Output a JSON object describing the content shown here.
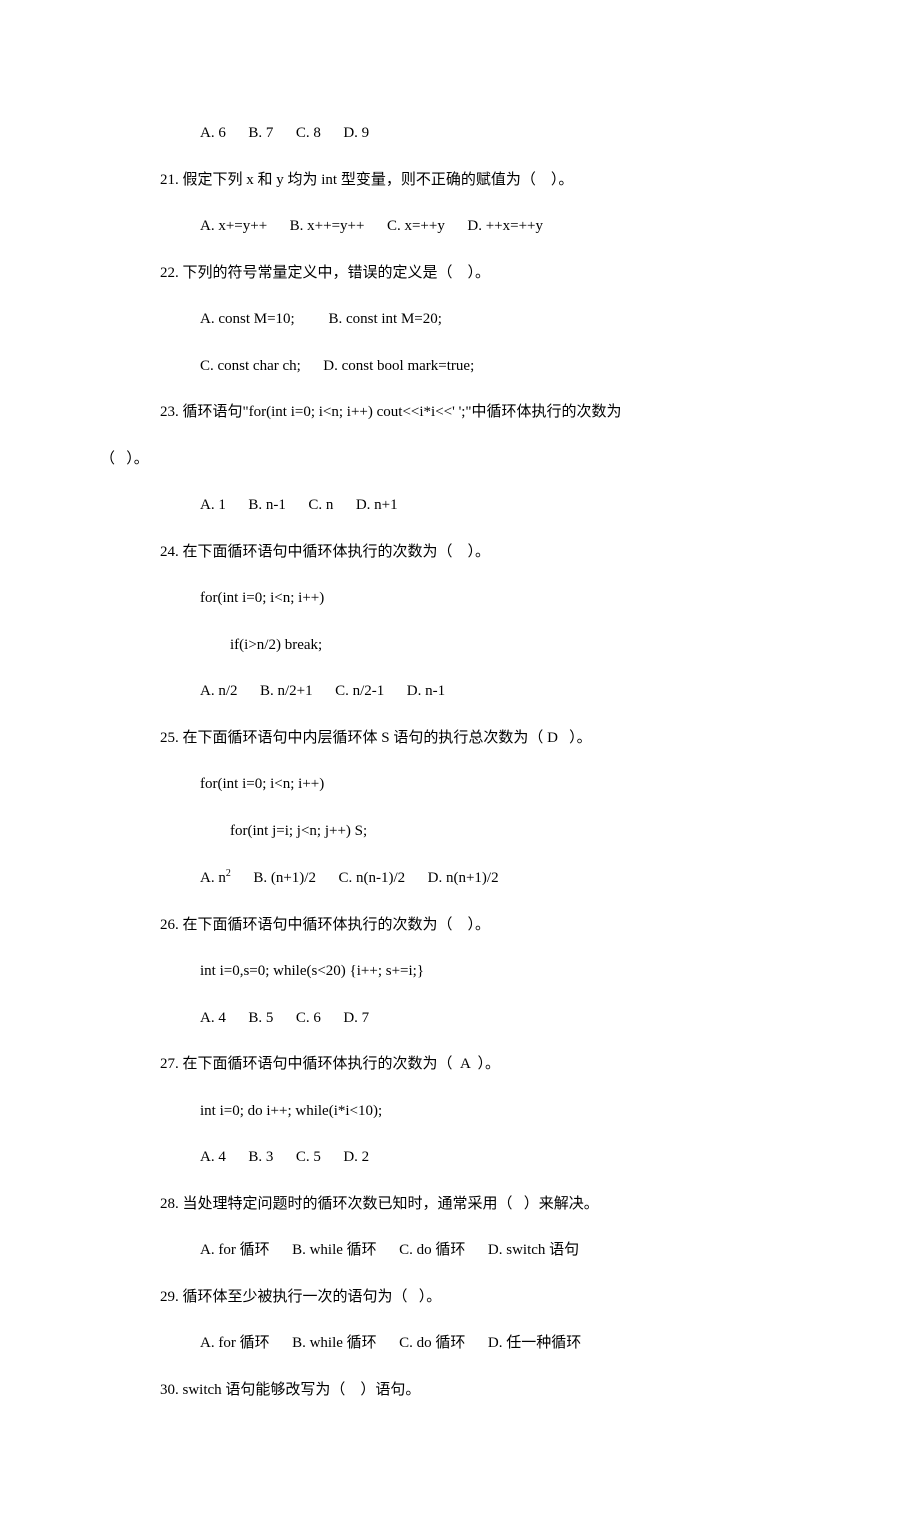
{
  "lines": {
    "opt20": "A. 6      B. 7      C. 8      D. 9",
    "q21": "21. 假定下列 x 和 y 均为 int 型变量，则不正确的赋值为（    ）。",
    "opt21": "A. x+=y++      B. x++=y++      C. x=++y      D. ++x=++y",
    "q22": "22. 下列的符号常量定义中，错误的定义是（    ）。",
    "opt22a": "A. const M=10;         B. const int M=20;",
    "opt22b": "C. const char ch;      D. const bool mark=true;",
    "q23a": "23. 循环语句\"for(int i=0; i<n; i++) cout<<i*i<<' ';\"中循环体执行的次数为",
    "q23b": "（   ）。",
    "opt23": "A. 1      B. n-1      C. n      D. n+1",
    "q24": "24. 在下面循环语句中循环体执行的次数为（    ）。",
    "code24a": "for(int i=0; i<n; i++)",
    "code24b": "if(i>n/2) break;",
    "opt24": "A. n/2      B. n/2+1      C. n/2-1      D. n-1",
    "q25": "25. 在下面循环语句中内层循环体 S 语句的执行总次数为（ D   ）。",
    "code25a": "for(int i=0; i<n; i++)",
    "code25b": "for(int j=i; j<n; j++) S;",
    "q26": "26. 在下面循环语句中循环体执行的次数为（    ）。",
    "code26": "int i=0,s=0; while(s<20) {i++; s+=i;}",
    "opt26": "A. 4      B. 5      C. 6      D. 7",
    "q27": "27. 在下面循环语句中循环体执行的次数为（  A  ）。",
    "code27": "int i=0; do i++; while(i*i<10);",
    "opt27": "A. 4      B. 3      C. 5      D. 2",
    "q28": "28. 当处理特定问题时的循环次数已知时，通常采用（   ）来解决。",
    "opt28": "A. for 循环      B. while 循环      C. do 循环      D. switch 语句",
    "q29": "29. 循环体至少被执行一次的语句为（   ）。",
    "opt29": "A. for 循环      B. while 循环      C. do 循环      D. 任一种循环",
    "q30": "30. switch 语句能够改写为（    ）语句。",
    "opt25_a": "A. n",
    "opt25_sup": "2",
    "opt25_rest": "      B. (n+1)/2      C. n(n-1)/2      D. n(n+1)/2"
  }
}
